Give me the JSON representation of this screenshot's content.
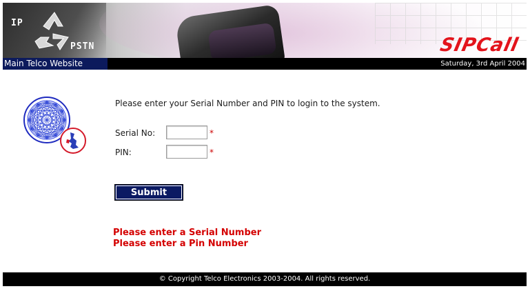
{
  "header": {
    "brand_ip": "IP",
    "brand_pstn": "PSTN",
    "product_logo": "SIPCall",
    "main_link": "Main Telco Website",
    "date": "Saturday, 3rd April 2004"
  },
  "login": {
    "instructions": "Please enter your Serial Number and PIN to login to the system.",
    "serial_label": "Serial No:",
    "serial_value": "",
    "pin_label": "PIN:",
    "pin_value": "",
    "required_marker": "*",
    "submit_label": "Submit"
  },
  "errors": [
    "Please enter a Serial Number",
    "Please enter a Pin Number"
  ],
  "footer": {
    "copyright": "© Copyright Telco Electronics 2003-2004. All rights reserved."
  },
  "icons": [
    "recycle-icon",
    "globe-network-icon",
    "uk-map-badge-icon"
  ],
  "colors": {
    "brand_red": "#e3131b",
    "navy": "#0b1a63",
    "error_red": "#d40000"
  }
}
